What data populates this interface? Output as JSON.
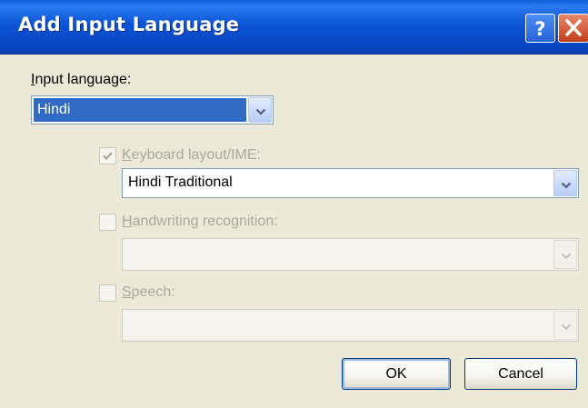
{
  "window": {
    "title": "Add Input Language",
    "help_icon": "question-mark-icon",
    "close_icon": "close-icon"
  },
  "input_language": {
    "label_accel": "I",
    "label_rest": "nput language:",
    "selected": "Hindi"
  },
  "keyboard_layout": {
    "checked": true,
    "label_accel": "K",
    "label_rest": "eyboard layout/IME:",
    "selected": "Hindi Traditional"
  },
  "handwriting": {
    "checked": false,
    "label_accel": "H",
    "label_rest": "andwriting recognition:",
    "selected": ""
  },
  "speech": {
    "checked": false,
    "label_accel": "S",
    "label_rest": "peech:",
    "selected": ""
  },
  "buttons": {
    "ok": "OK",
    "cancel": "Cancel"
  },
  "colors": {
    "titlebar": "#0a54d6",
    "selection": "#316ac5",
    "dialog_bg": "#ece9d8",
    "disabled_text": "#aca899"
  }
}
